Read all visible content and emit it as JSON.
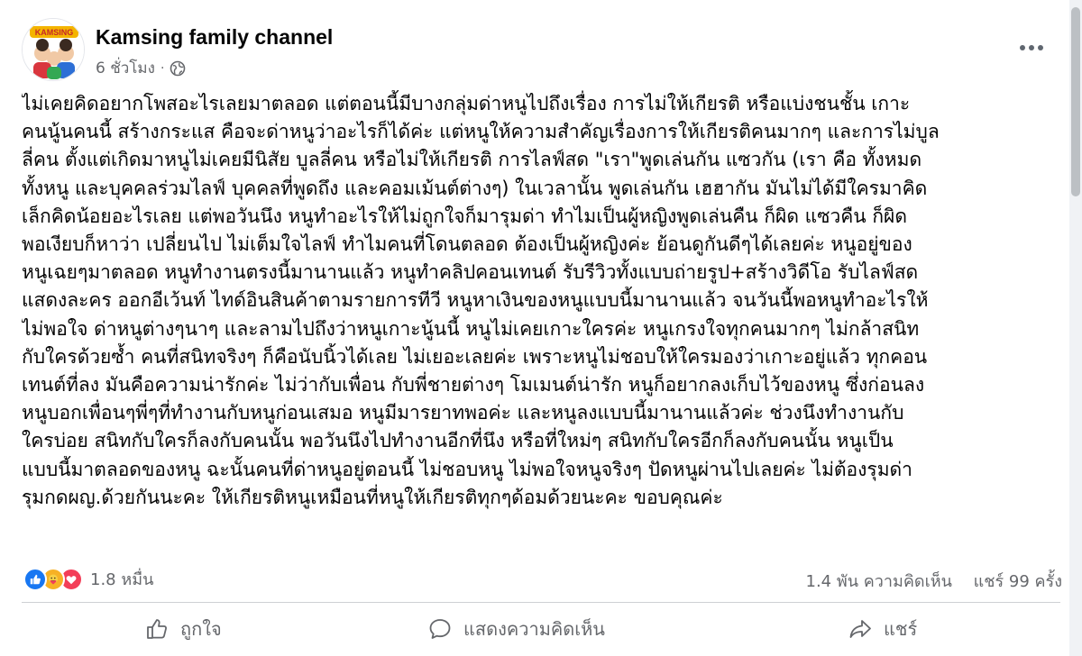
{
  "header": {
    "page_name": "Kamsing family channel",
    "time": "6 ชั่วโมง",
    "separator": "·",
    "avatar_text": "KAMSING"
  },
  "post": {
    "lines": [
      "ไม่เคยคิดอยากโพสอะไรเลยมาตลอด แต่ตอนนี้มีบางกลุ่มด่าหนูไปถึงเรื่อง การไม่ให้เกียรติ หรือแบ่งชนชั้น เกาะ",
      "คนนู้นคนนี้ สร้างกระแส คือจะด่าหนูว่าอะไรก็ได้ค่ะ แต่หนูให้ความสำคัญเรื่องการให้เกียรติคนมากๆ และการไม่บูล",
      "ลี่คน ตั้งแต่เกิดมาหนูไม่เคยมีนิสัย บูลลี่คน หรือไม่ให้เกียรติ การไลฟ์สด \"เรา\"พูดเล่นกัน แซวกัน (เรา คือ ทั้งหมด",
      "ทั้งหนู และบุคคลร่วมไลฟ์ บุคคลที่พูดถึง และคอมเม้นต์ต่างๆ) ในเวลานั้น พูดเล่นกัน เฮฮากัน มันไม่ได้มีใครมาคิด",
      "เล็กคิดน้อยอะไรเลย แต่พอวันนึง หนูทำอะไรให้ไม่ถูกใจก็มารุมด่า ทำไมเป็นผู้หญิงพูดเล่นคืน ก็ผิด แซวคืน ก็ผิด",
      "พอเงียบก็หาว่า เปลี่ยนไป ไม่เต็มใจไลฟ์ ทำไมคนที่โดนตลอด ต้องเป็นผู้หญิงค่ะ ย้อนดูกันดีๆได้เลยค่ะ หนูอยู่ของ",
      "หนูเฉยๆมาตลอด หนูทำงานตรงนี้มานานแล้ว หนูทำคลิปคอนเทนต์ รับรีวิวทั้งแบบถ่ายรูป+สร้างวิดีโอ รับไลฟ์สด",
      "แสดงละคร ออกอีเว้นท์ ไทด์อินสินค้าตามรายการทีวี หนูหาเงินของหนูแบบนี้มานานแล้ว จนวันนี้พอหนูทำอะไรให้",
      "ไม่พอใจ ด่าหนูต่างๆนาๆ และลามไปถึงว่าหนูเกาะนู้นนี้ หนูไม่เคยเกาะใครค่ะ หนูเกรงใจทุกคนมากๆ ไม่กล้าสนิท",
      "กับใครด้วยซ้ำ คนที่สนิทจริงๆ ก็คือนับนิ้วได้เลย ไม่เยอะเลยค่ะ เพราะหนูไม่ชอบให้ใครมองว่าเกาะอยู่แล้ว ทุกคอน",
      "เทนต์ที่ลง มันคือความน่ารักค่ะ ไม่ว่ากับเพื่อน กับพี่ชายต่างๆ โมเมนต์น่ารัก หนูก็อยากลงเก็บไว้ของหนู ซึ่งก่อนลง",
      "หนูบอกเพื่อนๆพี่ๆที่ทำงานกับหนูก่อนเสมอ หนูมีมารยาทพอค่ะ และหนูลงแบบนี้มานานแล้วค่ะ ช่วงนึงทำงานกับ",
      "ใครบ่อย สนิทกับใครก็ลงกับคนนั้น พอวันนึงไปทำงานอีกที่นึง หรือที่ใหม่ๆ สนิทกับใครอีกก็ลงกับคนนั้น หนูเป็น",
      "แบบนี้มาตลอดของหนู ฉะนั้นคนที่ด่าหนูอยู่ตอนนี้ ไม่ชอบหนู ไม่พอใจหนูจริงๆ ปัดหนูผ่านไปเลยค่ะ ไม่ต้องรุมด่า",
      "รุมกดผญ.ด้วยกันนะคะ ให้เกียรติหนูเหมือนที่หนูให้เกียรติทุกๆด้อมด้วยนะคะ ขอบคุณค่ะ"
    ]
  },
  "stats": {
    "reaction_count": "1.8 หมื่น",
    "comments": "1.4 พัน ความคิดเห็น",
    "shares": "แชร์ 99 ครั้ง",
    "reactions": [
      "like-icon",
      "care-icon",
      "love-icon"
    ]
  },
  "actions": {
    "like": "ถูกใจ",
    "comment": "แสดงความคิดเห็น",
    "share": "แชร์"
  },
  "colors": {
    "like": "#1877f2",
    "care": "#f7b125",
    "love": "#f33e58",
    "secondary_text": "#65676b"
  }
}
